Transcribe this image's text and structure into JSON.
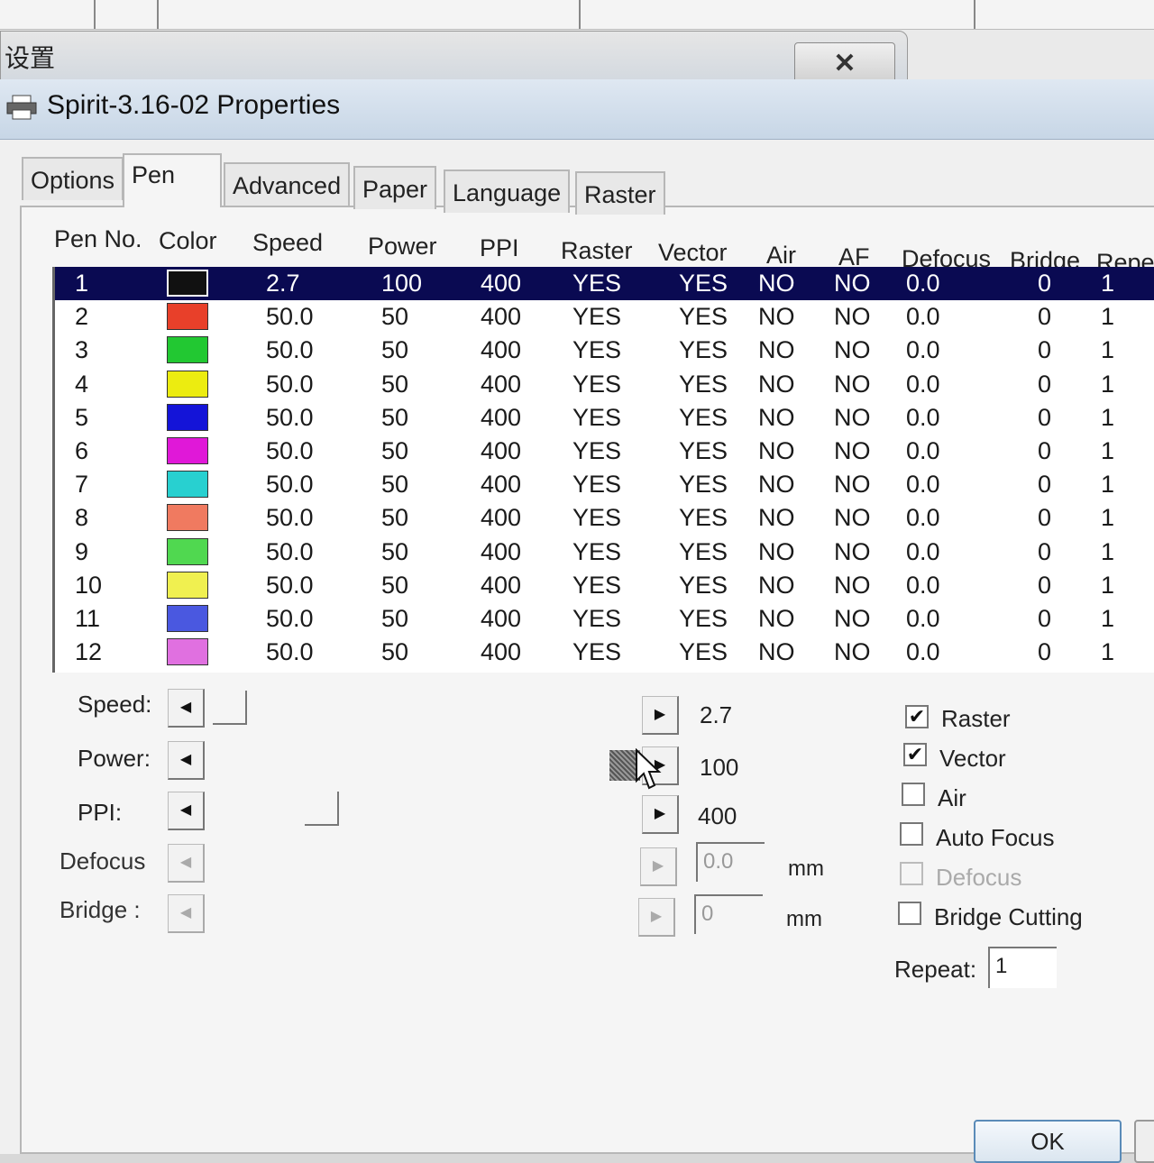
{
  "background_window": {
    "title": "设置",
    "close_glyph": "✕"
  },
  "dialog": {
    "title": "Spirit-3.16-02 Properties"
  },
  "tabs": [
    {
      "label": "Options"
    },
    {
      "label": "Pen"
    },
    {
      "label": "Advanced"
    },
    {
      "label": "Paper"
    },
    {
      "label": "Language"
    },
    {
      "label": "Raster"
    }
  ],
  "table": {
    "headers": [
      "Pen No.",
      "Color",
      "Speed",
      "Power",
      "PPI",
      "Raster",
      "Vector",
      "Air",
      "AF",
      "Defocus",
      "Bridge",
      "Repe"
    ],
    "rows": [
      {
        "no": "1",
        "color": "#111111",
        "speed": "2.7",
        "power": "100",
        "ppi": "400",
        "raster": "YES",
        "vector": "YES",
        "air": "NO",
        "af": "NO",
        "defocus": "0.0",
        "bridge": "0",
        "repeat": "1"
      },
      {
        "no": "2",
        "color": "#e8402a",
        "speed": "50.0",
        "power": "50",
        "ppi": "400",
        "raster": "YES",
        "vector": "YES",
        "air": "NO",
        "af": "NO",
        "defocus": "0.0",
        "bridge": "0",
        "repeat": "1"
      },
      {
        "no": "3",
        "color": "#22c832",
        "speed": "50.0",
        "power": "50",
        "ppi": "400",
        "raster": "YES",
        "vector": "YES",
        "air": "NO",
        "af": "NO",
        "defocus": "0.0",
        "bridge": "0",
        "repeat": "1"
      },
      {
        "no": "4",
        "color": "#ecec10",
        "speed": "50.0",
        "power": "50",
        "ppi": "400",
        "raster": "YES",
        "vector": "YES",
        "air": "NO",
        "af": "NO",
        "defocus": "0.0",
        "bridge": "0",
        "repeat": "1"
      },
      {
        "no": "5",
        "color": "#1414d8",
        "speed": "50.0",
        "power": "50",
        "ppi": "400",
        "raster": "YES",
        "vector": "YES",
        "air": "NO",
        "af": "NO",
        "defocus": "0.0",
        "bridge": "0",
        "repeat": "1"
      },
      {
        "no": "6",
        "color": "#e018d8",
        "speed": "50.0",
        "power": "50",
        "ppi": "400",
        "raster": "YES",
        "vector": "YES",
        "air": "NO",
        "af": "NO",
        "defocus": "0.0",
        "bridge": "0",
        "repeat": "1"
      },
      {
        "no": "7",
        "color": "#28d0d0",
        "speed": "50.0",
        "power": "50",
        "ppi": "400",
        "raster": "YES",
        "vector": "YES",
        "air": "NO",
        "af": "NO",
        "defocus": "0.0",
        "bridge": "0",
        "repeat": "1"
      },
      {
        "no": "8",
        "color": "#f07a60",
        "speed": "50.0",
        "power": "50",
        "ppi": "400",
        "raster": "YES",
        "vector": "YES",
        "air": "NO",
        "af": "NO",
        "defocus": "0.0",
        "bridge": "0",
        "repeat": "1"
      },
      {
        "no": "9",
        "color": "#50d850",
        "speed": "50.0",
        "power": "50",
        "ppi": "400",
        "raster": "YES",
        "vector": "YES",
        "air": "NO",
        "af": "NO",
        "defocus": "0.0",
        "bridge": "0",
        "repeat": "1"
      },
      {
        "no": "10",
        "color": "#f0f050",
        "speed": "50.0",
        "power": "50",
        "ppi": "400",
        "raster": "YES",
        "vector": "YES",
        "air": "NO",
        "af": "NO",
        "defocus": "0.0",
        "bridge": "0",
        "repeat": "1"
      },
      {
        "no": "11",
        "color": "#4a58e0",
        "speed": "50.0",
        "power": "50",
        "ppi": "400",
        "raster": "YES",
        "vector": "YES",
        "air": "NO",
        "af": "NO",
        "defocus": "0.0",
        "bridge": "0",
        "repeat": "1"
      },
      {
        "no": "12",
        "color": "#e070e0",
        "speed": "50.0",
        "power": "50",
        "ppi": "400",
        "raster": "YES",
        "vector": "YES",
        "air": "NO",
        "af": "NO",
        "defocus": "0.0",
        "bridge": "0",
        "repeat": "1"
      }
    ]
  },
  "controls": {
    "speed": {
      "label": "Speed:",
      "value": "2.7"
    },
    "power": {
      "label": "Power:",
      "value": "100"
    },
    "ppi": {
      "label": "PPI:",
      "value": "400"
    },
    "defocus": {
      "label": "Defocus",
      "value": "0.0",
      "unit": "mm"
    },
    "bridge": {
      "label": "Bridge :",
      "value": "0",
      "unit": "mm"
    }
  },
  "checkboxes": [
    {
      "label": "Raster",
      "checked": true,
      "enabled": true
    },
    {
      "label": "Vector",
      "checked": true,
      "enabled": true
    },
    {
      "label": "Air",
      "checked": false,
      "enabled": true
    },
    {
      "label": "Auto Focus",
      "checked": false,
      "enabled": true
    },
    {
      "label": "Defocus",
      "checked": false,
      "enabled": false
    },
    {
      "label": "Bridge Cutting",
      "checked": false,
      "enabled": true
    }
  ],
  "repeat": {
    "label": "Repeat:",
    "value": "1"
  },
  "buttons": {
    "ok": "OK"
  },
  "glyphs": {
    "left": "◀",
    "right": "▶",
    "check": "✔"
  }
}
